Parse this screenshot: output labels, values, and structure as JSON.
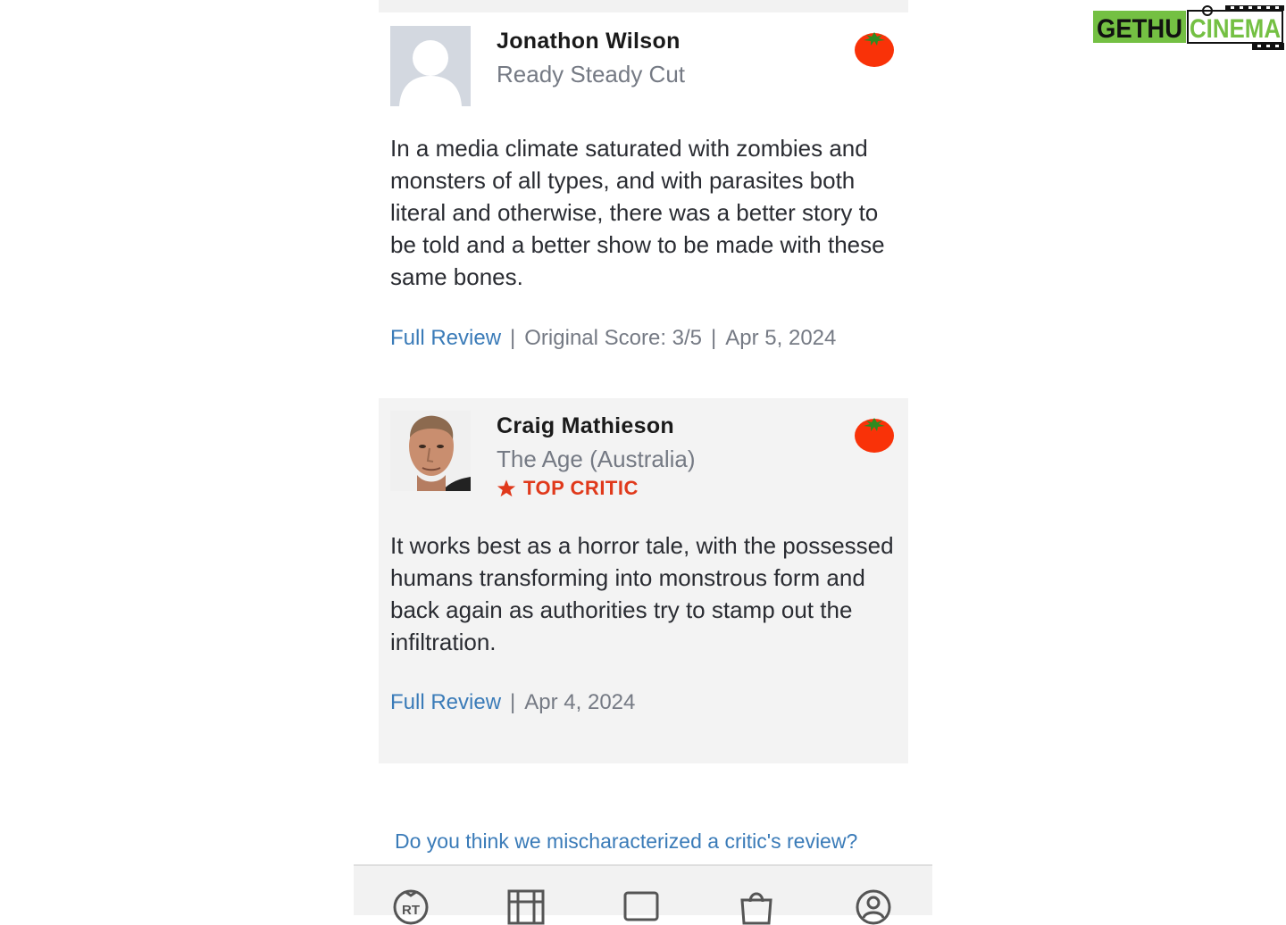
{
  "reviews": [
    {
      "critic_name": "Jonathon Wilson",
      "publication": "Ready Steady Cut",
      "top_critic": false,
      "quote": "In a media climate saturated with zombies and monsters of all types, and with parasites both literal and otherwise, there was a better story to be told and a better show to be made with these same bones.",
      "full_review_label": "Full Review",
      "original_score": "Original Score: 3/5",
      "date": "Apr 5, 2024",
      "icon": "fresh-tomato-icon"
    },
    {
      "critic_name": "Craig Mathieson",
      "publication": "The Age (Australia)",
      "top_critic": true,
      "top_critic_label": "TOP CRITIC",
      "quote": "It works best as a horror tale, with the possessed humans transforming into monstrous form and back again as authorities try to stamp out the infiltration.",
      "full_review_label": "Full Review",
      "date": "Apr 4, 2024",
      "icon": "fresh-tomato-icon"
    }
  ],
  "feedback_link": "Do you think we mischaracterized a critic's review?",
  "bottom_nav": {
    "items": [
      "rt-home-icon",
      "movies-film-icon",
      "tv-icon",
      "shopping-bag-icon",
      "profile-icon"
    ]
  },
  "watermark": {
    "text": "GETHUCINEMA"
  },
  "colors": {
    "link": "#3a7bb8",
    "top_critic": "#e0391b",
    "tomato": "#f93208",
    "stem": "#2e8a20"
  }
}
